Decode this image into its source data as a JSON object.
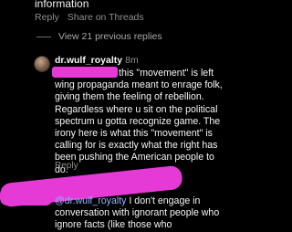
{
  "thread": {
    "prev_line": "information",
    "actions": {
      "reply": "Reply",
      "share": "Share on Threads"
    },
    "view_replies": "View 21 previous replies"
  },
  "comment1": {
    "username": "dr.wulf_royalty",
    "time": "8m",
    "text": "this \"movement\" is left wing propaganda meant to enrage folk, giving them the feeling of rebellion. Regardless where u sit on the political spectrum u gotta recognize game. The irony here is what this \"movement\" is calling for is exactly what the right has been pushing the American people to do.",
    "reply": "Reply"
  },
  "comment2": {
    "mention": "@dr.wulf_royalty",
    "text": " I don't engage in conversation with ignorant people who ignore facts (like those who"
  },
  "colors": {
    "redaction": "#e63ad6",
    "mention": "#8fb5ff",
    "muted": "#8e8e8e"
  }
}
